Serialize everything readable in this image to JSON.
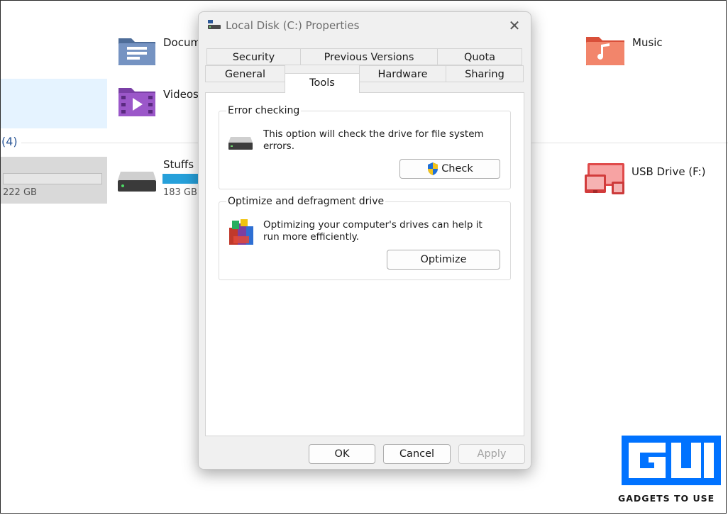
{
  "background": {
    "folders": {
      "documents": "Docum",
      "videos": "Videos",
      "music": "Music"
    },
    "drives_group_count": "(4)",
    "drives": {
      "left_size": "222 GB",
      "stuffs_name": "Stuffs (",
      "stuffs_size": "183 GB",
      "usb_name": "USB Drive (F:)"
    }
  },
  "dialog": {
    "title": "Local Disk (C:) Properties",
    "tabs_row1": [
      "Security",
      "Previous Versions",
      "Quota"
    ],
    "tabs_row2": [
      "General",
      "Tools",
      "Hardware",
      "Sharing"
    ],
    "active_tab": "Tools",
    "error_checking": {
      "title": "Error checking",
      "description": "This option will check the drive for file system errors.",
      "button": "Check"
    },
    "optimize": {
      "title": "Optimize and defragment drive",
      "description": "Optimizing your computer's drives can help it run more efficiently.",
      "button": "Optimize"
    },
    "footer": {
      "ok": "OK",
      "cancel": "Cancel",
      "apply": "Apply"
    }
  },
  "watermark": {
    "text": "GADGETS TO USE"
  },
  "colors": {
    "accent_blue": "#0072ff",
    "annotation_red": "#d42424",
    "usage_bar": "#26a0da"
  }
}
